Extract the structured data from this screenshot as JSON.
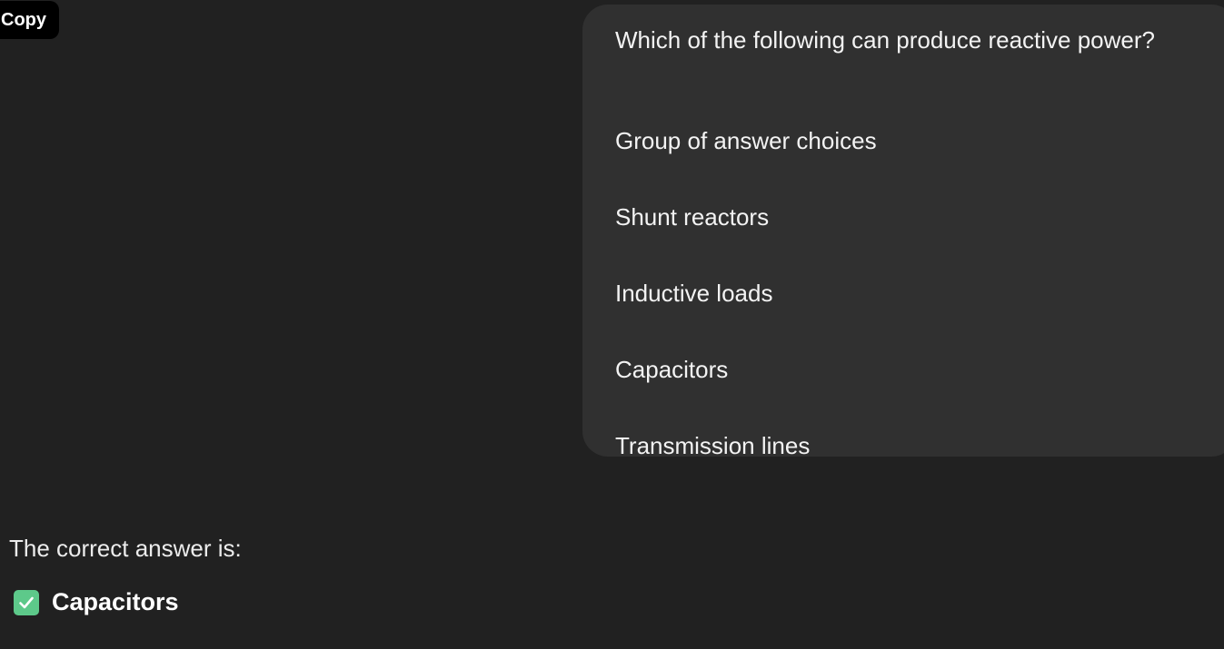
{
  "toolbar": {
    "copy_label": "Copy"
  },
  "user_message": {
    "question": "Which of the following can produce reactive power?",
    "group_label": "Group of answer choices",
    "choices": [
      "Shunt reactors",
      "Inductive loads",
      "Capacitors",
      "Transmission lines"
    ]
  },
  "assistant_message": {
    "intro": "The correct answer is:",
    "answer_icon": "check-mark-button-icon",
    "answer": "Capacitors"
  },
  "colors": {
    "background": "#212121",
    "bubble": "#303030",
    "check": "#5dc98a"
  }
}
